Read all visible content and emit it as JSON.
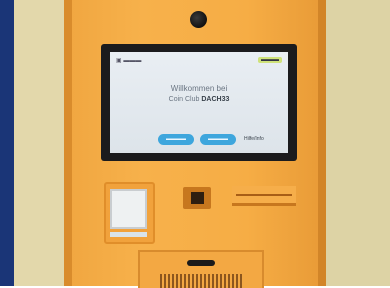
{
  "scene": {
    "description_colors": {
      "kiosk_body": "#f6ad45",
      "screen_button": "#3ea6dd",
      "bezel": "#1b1b1d",
      "background_blue": "#1d3c86",
      "wall": "#ddd3a5"
    }
  },
  "screen": {
    "logo_text": "▣ ▬▬▬",
    "language_badge": "▬▬▬",
    "line1": "Willkommen bei",
    "line2_prefix": "Coin Club",
    "line2_bold": "DACH33",
    "button1": "▬▬▬▬",
    "button2": "▬▬▬▬",
    "link": "Hilfe/Info"
  }
}
